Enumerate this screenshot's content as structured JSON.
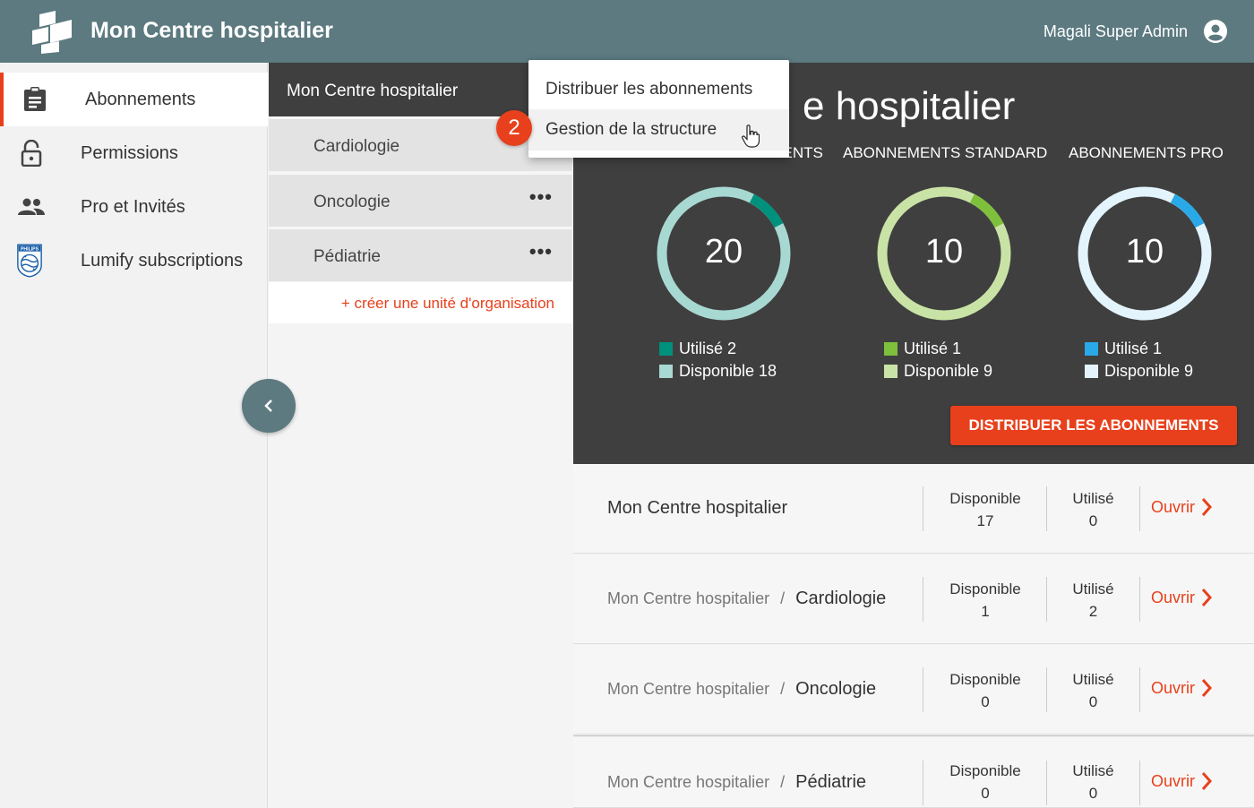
{
  "header": {
    "app_title": "Mon Centre hospitalier",
    "user_name": "Magali Super Admin"
  },
  "sidebar": {
    "items": [
      {
        "label": "Abonnements",
        "icon": "clipboard-icon",
        "active": true
      },
      {
        "label": "Permissions",
        "icon": "lock-icon",
        "active": false
      },
      {
        "label": "Pro et Invités",
        "icon": "people-icon",
        "active": false
      },
      {
        "label": "Lumify subscriptions",
        "icon": "philips-logo-icon",
        "active": false
      }
    ]
  },
  "org_panel": {
    "title": "Mon Centre hospitalier",
    "units": [
      {
        "label": "Cardiologie"
      },
      {
        "label": "Oncologie",
        "menu": "•••"
      },
      {
        "label": "Pédiatrie",
        "menu": "•••"
      }
    ],
    "create_label": "+ créer une unité d'organisation"
  },
  "dropdown": {
    "items": [
      "Distribuer les abonnements",
      "Gestion de la structure"
    ],
    "step_badge": "2"
  },
  "dashboard": {
    "title_visible": "e hospitalier",
    "columns": [
      {
        "header": "TOUS LES ABONNEMENTS",
        "total": "20",
        "used_label": "Utilisé 2",
        "available_label": "Disponible 18",
        "used": 2,
        "available": 18,
        "used_color": "#00917c",
        "available_color": "#a8d8d2"
      },
      {
        "header": "ABONNEMENTS STANDARD",
        "total": "10",
        "used_label": "Utilisé 1",
        "available_label": "Disponible 9",
        "used": 1,
        "available": 9,
        "used_color": "#7ebf3c",
        "available_color": "#c9e3a6"
      },
      {
        "header": "ABONNEMENTS PRO",
        "total": "10",
        "used_label": "Utilisé 1",
        "available_label": "Disponible 9",
        "used": 1,
        "available": 9,
        "used_color": "#29a9e8",
        "available_color": "#e3f4fc"
      }
    ],
    "button_label": "DISTRIBUER LES ABONNEMENTS"
  },
  "table": {
    "rows": [
      {
        "parent": "",
        "name": "Mon Centre hospitalier",
        "available_label": "Disponible",
        "available": "17",
        "used_label": "Utilisé",
        "used": "0",
        "open_label": "Ouvrir"
      },
      {
        "parent": "Mon Centre hospitalier",
        "name": "Cardiologie",
        "available_label": "Disponible",
        "available": "1",
        "used_label": "Utilisé",
        "used": "2",
        "open_label": "Ouvrir"
      },
      {
        "parent": "Mon Centre hospitalier",
        "name": "Oncologie",
        "available_label": "Disponible",
        "available": "0",
        "used_label": "Utilisé",
        "used": "0",
        "open_label": "Ouvrir"
      },
      {
        "parent": "Mon Centre hospitalier",
        "name": "Pédiatrie",
        "available_label": "Disponible",
        "available": "0",
        "used_label": "Utilisé",
        "used": "0",
        "open_label": "Ouvrir"
      }
    ],
    "separator": "/"
  },
  "colors": {
    "header_bg": "#5c7a80",
    "accent": "#e8401c",
    "dark_panel": "#3f3f3f"
  }
}
